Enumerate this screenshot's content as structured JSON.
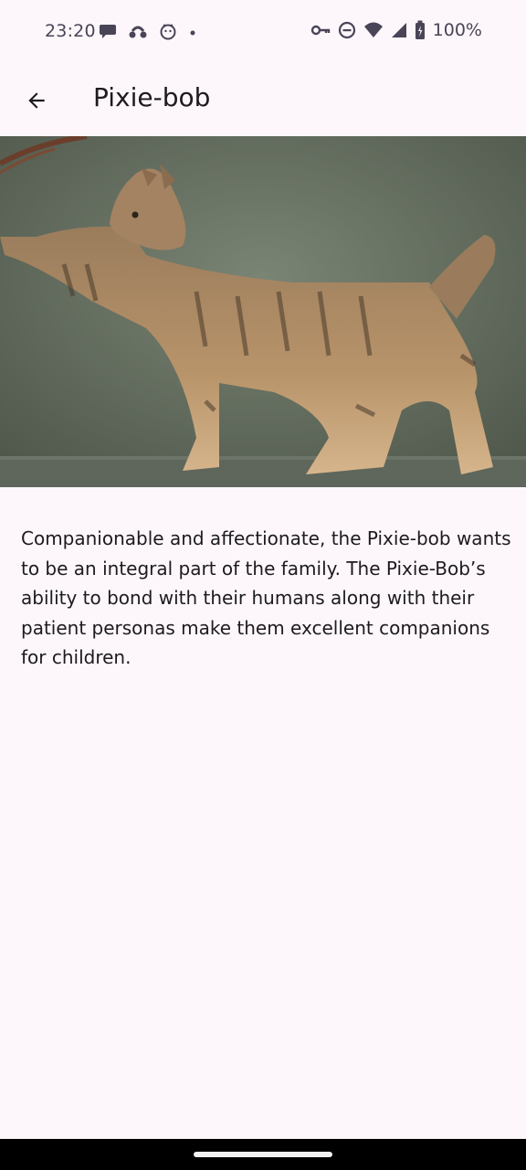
{
  "status_bar": {
    "time": "23:20",
    "battery_text": "100%",
    "left_icons": [
      "chat-bubble-icon",
      "voicemail-icon",
      "cat-face-icon",
      "dot-icon"
    ],
    "right_icons": [
      "vpn-key-icon",
      "do-not-disturb-icon",
      "wifi-icon",
      "cellular-signal-icon",
      "battery-icon"
    ]
  },
  "app_bar": {
    "back_icon": "arrow-back-icon",
    "title": "Pixie-bob"
  },
  "hero": {
    "image_subject": "pixie-bob-cat-photo"
  },
  "description": "Companionable and affectionate, the Pixie-bob wants to be an integral part of the family. The Pixie-Bob’s ability to bond with their humans along with their patient personas make them excellent companions for children.",
  "colors": {
    "background": "#fdf7fb",
    "text": "#1d1b20",
    "status": "#4a4458"
  }
}
